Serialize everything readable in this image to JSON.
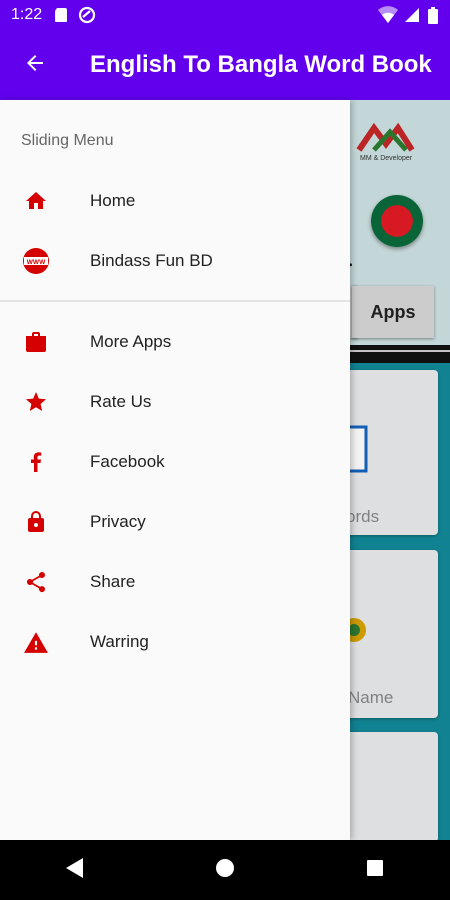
{
  "status_bar": {
    "time": "1:22"
  },
  "app_bar": {
    "title": "English To Bangla Word Book"
  },
  "background": {
    "logo_text": "MM & Developer",
    "button_apps": "Apps",
    "card1_label": "ords",
    "card2_label": "Name"
  },
  "drawer": {
    "section_title": "Sliding Menu",
    "items": [
      {
        "label": "Home",
        "icon": "home-icon"
      },
      {
        "label": "Bindass Fun BD",
        "icon": "www-icon"
      },
      {
        "label": "More Apps",
        "icon": "shopping-bag-icon"
      },
      {
        "label": "Rate Us",
        "icon": "star-icon"
      },
      {
        "label": "Facebook",
        "icon": "facebook-icon"
      },
      {
        "label": "Privacy",
        "icon": "lock-icon"
      },
      {
        "label": "Share",
        "icon": "share-icon"
      },
      {
        "label": "Warring",
        "icon": "warning-icon"
      }
    ]
  },
  "colors": {
    "primary": "#6200EE",
    "icon": "#D50000"
  }
}
